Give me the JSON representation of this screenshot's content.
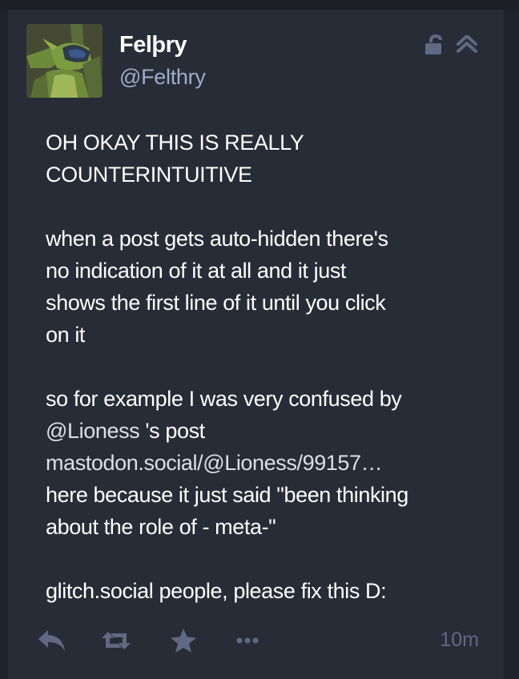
{
  "status": {
    "author": {
      "display_name": "Felþry",
      "handle": "@Felthry"
    },
    "content": {
      "paragraph_1": [
        "OH OKAY THIS IS REALLY",
        "COUNTERINTUITIVE"
      ],
      "paragraph_2": [
        "when a post gets auto-hidden there's",
        "no indication of it at all and it just",
        "shows the first line of it until you click",
        "on it"
      ],
      "paragraph_3": {
        "line_1": "so for example I was very confused by",
        "mention": "@Lioness",
        "after_mention": " 's post",
        "link": "mastodon.social/@Lioness/99157…",
        "line_4": "here because it just said \"been thinking",
        "line_5": "about the role of - meta-\""
      },
      "paragraph_4": [
        "glitch.social people, please fix this D:"
      ]
    },
    "timestamp": "10m"
  },
  "icons": {
    "visibility": "unlocked-icon",
    "collapse": "double-chevron-up-icon",
    "reply": "reply-icon",
    "boost": "boost-icon",
    "favourite": "star-icon",
    "more": "more-icon"
  },
  "colors": {
    "background": "#282c37",
    "text": "#ffffff",
    "secondary": "#9baec8",
    "icon": "#606984",
    "mention": "#d9e1e8"
  }
}
